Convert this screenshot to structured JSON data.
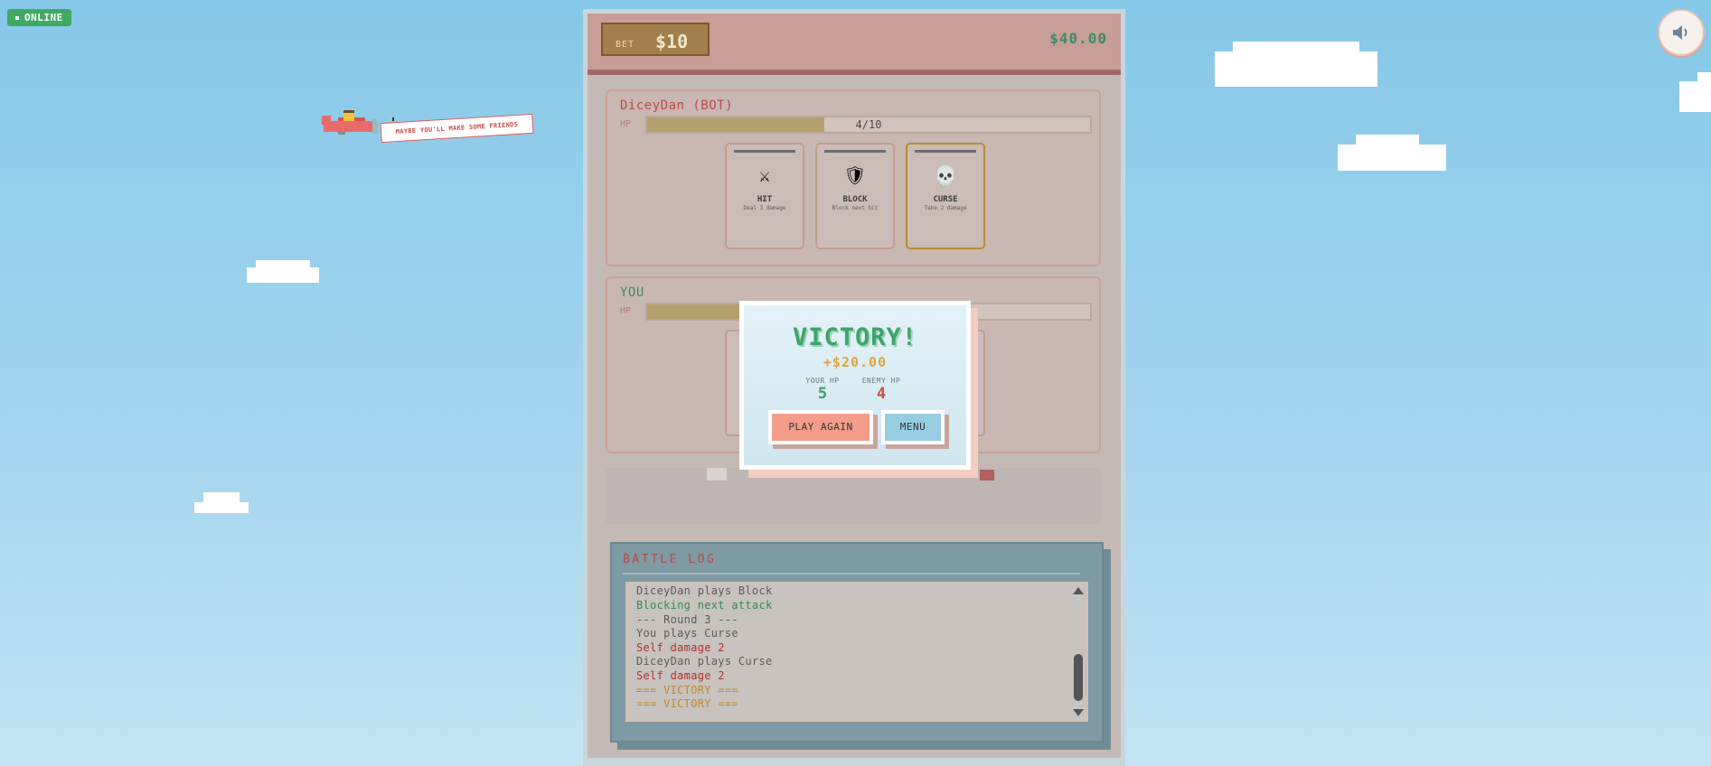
{
  "status": {
    "label": "ONLINE"
  },
  "sound": {
    "icon": "speaker-icon"
  },
  "plane": {
    "banner_text": "MAYBE YOU'LL MAKE SOME FRIENDS"
  },
  "header": {
    "bet_label": "BET",
    "bet_amount": "$10",
    "balance": "$40.00"
  },
  "enemy": {
    "name": "DiceyDan (BOT)",
    "hp_label": "HP",
    "hp_text": "4/10",
    "hp_fraction": 0.4,
    "cards": [
      {
        "icon": "crossed-swords-icon",
        "glyph": "⚔",
        "name": "HIT",
        "desc": "Deal 3 damage"
      },
      {
        "icon": "shield-icon",
        "glyph": "🛡",
        "name": "BLOCK",
        "desc": "Block next hit"
      },
      {
        "icon": "skull-icon",
        "glyph": "💀",
        "name": "CURSE",
        "desc": "Take 2 damage"
      }
    ]
  },
  "player": {
    "name": "YOU",
    "hp_label": "HP",
    "hp_fraction": 0.5
  },
  "battle_log": {
    "title": "BATTLE LOG",
    "lines": [
      {
        "text": "DiceyDan plays Block",
        "color": "#5a5a5a"
      },
      {
        "text": "Blocking next attack",
        "color": "#2e8b57"
      },
      {
        "text": "--- Round 3 ---",
        "color": "#5a5a5a"
      },
      {
        "text": "You plays Curse",
        "color": "#5a5a5a"
      },
      {
        "text": "Self damage 2",
        "color": "#b03030"
      },
      {
        "text": "DiceyDan plays Curse",
        "color": "#5a5a5a"
      },
      {
        "text": "Self damage 2",
        "color": "#b03030"
      },
      {
        "text": "=== VICTORY ===",
        "color": "#c8862a"
      },
      {
        "text": "=== VICTORY ===",
        "color": "#c8862a"
      }
    ]
  },
  "result": {
    "title": "VICTORY!",
    "winnings": "+$20.00",
    "your_hp_label": "YOUR HP",
    "your_hp": "5",
    "enemy_hp_label": "ENEMY HP",
    "enemy_hp": "4",
    "play_again_label": "PLAY AGAIN",
    "menu_label": "MENU"
  }
}
